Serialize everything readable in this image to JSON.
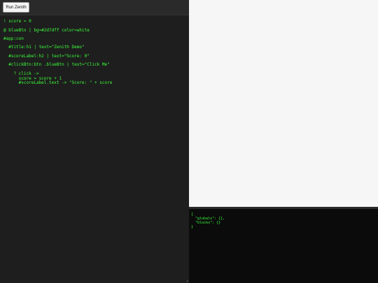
{
  "toolbar": {
    "run_label": "Run Zenith"
  },
  "editor": {
    "lines": [
      "! score = 0",
      "@ blueBtn | bg=#2d7dff color=white",
      "#app:con",
      "  #title:h1 | text=\"Zenith Demo\"",
      "  #scoreLabel:h2 | text=\"Score: 0\"",
      "  #clickBtn:btn .blueBtn | text=\"Click Me\"",
      "    ? click ->",
      "      score = score + 1",
      "      #scoreLabel.text -> \"Score: \" + score"
    ]
  },
  "console": {
    "lines": [
      "{",
      "  \"globals\": {},",
      "  \"blocks\": {}",
      "}"
    ]
  },
  "colors": {
    "code_text": "#3bff3b",
    "editor_bg": "#1e1e1e",
    "preview_bg": "#f6f6f6",
    "console_bg": "#0b0b0b"
  }
}
